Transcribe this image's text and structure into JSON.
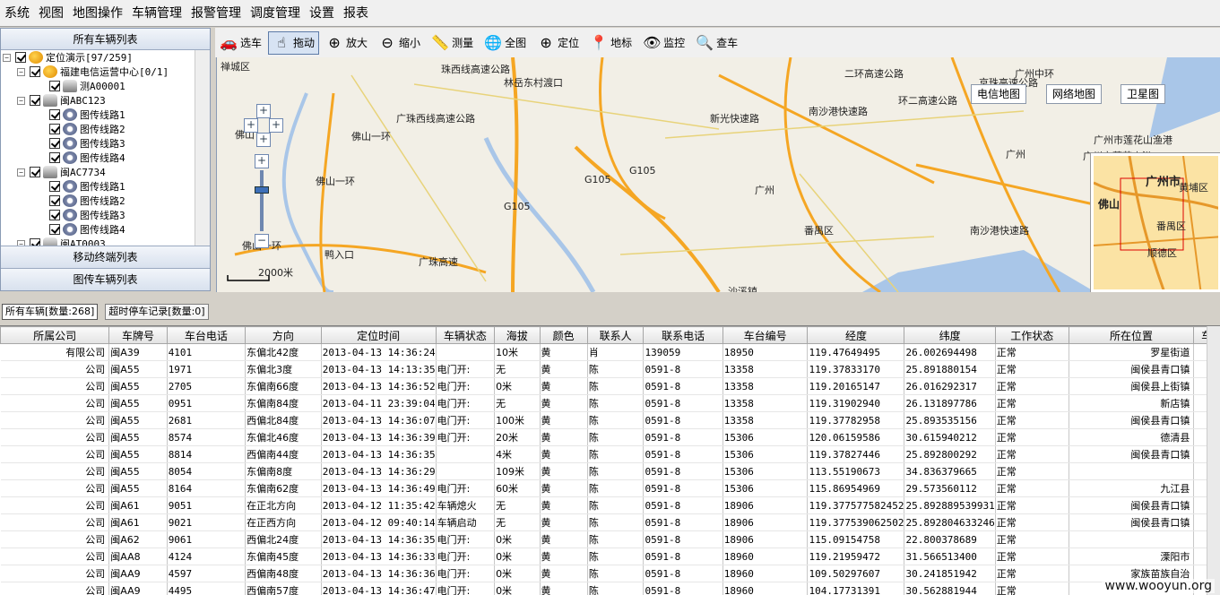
{
  "menu": [
    "系统",
    "视图",
    "地图操作",
    "车辆管理",
    "报警管理",
    "调度管理",
    "设置",
    "报表"
  ],
  "left": {
    "header": "所有车辆列表",
    "tree": [
      {
        "level": 0,
        "exp": "−",
        "icon": "globe-icon",
        "label": "定位演示[97/259]"
      },
      {
        "level": 1,
        "exp": "−",
        "icon": "globe-icon",
        "label": "福建电信运营中心[0/1]"
      },
      {
        "level": 2,
        "exp": "",
        "icon": "car-icon",
        "label": "测A00001"
      },
      {
        "level": 1,
        "exp": "−",
        "icon": "car-icon",
        "label": "闽ABC123"
      },
      {
        "level": 2,
        "exp": "",
        "icon": "camera-icon",
        "label": "图传线路1"
      },
      {
        "level": 2,
        "exp": "",
        "icon": "camera-icon",
        "label": "图传线路2"
      },
      {
        "level": 2,
        "exp": "",
        "icon": "camera-icon",
        "label": "图传线路3"
      },
      {
        "level": 2,
        "exp": "",
        "icon": "camera-icon",
        "label": "图传线路4"
      },
      {
        "level": 1,
        "exp": "−",
        "icon": "car-icon",
        "label": "闽AC7734"
      },
      {
        "level": 2,
        "exp": "",
        "icon": "camera-icon",
        "label": "图传线路1"
      },
      {
        "level": 2,
        "exp": "",
        "icon": "camera-icon",
        "label": "图传线路2"
      },
      {
        "level": 2,
        "exp": "",
        "icon": "camera-icon",
        "label": "图传线路3"
      },
      {
        "level": 2,
        "exp": "",
        "icon": "camera-icon",
        "label": "图传线路4"
      },
      {
        "level": 1,
        "exp": "−",
        "icon": "car-icon",
        "label": "闽AT0003"
      }
    ],
    "acc1": "移动终端列表",
    "acc2": "图传车辆列表"
  },
  "toolbar": [
    {
      "icon": "car-select-icon",
      "glyph": "🚗",
      "label": "选车"
    },
    {
      "icon": "hand-icon",
      "glyph": "☝",
      "label": "拖动",
      "active": true
    },
    {
      "icon": "zoom-in-icon",
      "glyph": "⊕",
      "label": "放大"
    },
    {
      "icon": "zoom-out-icon",
      "glyph": "⊖",
      "label": "缩小"
    },
    {
      "icon": "measure-icon",
      "glyph": "📏",
      "label": "测量"
    },
    {
      "icon": "globe-icon",
      "glyph": "🌐",
      "label": "全图"
    },
    {
      "icon": "crosshair-icon",
      "glyph": "⊕",
      "label": "定位"
    },
    {
      "icon": "pin-icon",
      "glyph": "📍",
      "label": "地标"
    },
    {
      "icon": "eye-icon",
      "glyph": "👁",
      "label": "监控"
    },
    {
      "icon": "search-icon",
      "glyph": "🔍",
      "label": "查车"
    }
  ],
  "map": {
    "btns": [
      "电信地图",
      "网络地图",
      "卫星图"
    ],
    "scale": "2000米",
    "labels": [
      "禅城区",
      "珠西线高速公路",
      "林岳东村渡口",
      "佛山",
      "南沙港快速路",
      "新光快速路",
      "广州市莲花山渔港",
      "广州市莲花山港",
      "番禺区",
      "南沙港快速路",
      "佛山一环",
      "佛山一环",
      "佛山一环",
      "广珠西线高速公路",
      "G105",
      "G105",
      "G105",
      "沙溪镇",
      "鸭入口",
      "广州市",
      "黄埔区",
      "佛山",
      "番禺区",
      "顺德区",
      "广州中环",
      "广州",
      "广州",
      "京珠高速公路",
      "二环高速公路",
      "环二高速公路",
      "广珠高速"
    ],
    "inset_labels": [
      "广州市",
      "黄埔区",
      "佛山",
      "番禺区",
      "顺德区"
    ]
  },
  "tabs": [
    "所有车辆[数量:268]",
    "超时停车记录[数量:0]"
  ],
  "grid": {
    "columns": [
      "所属公司",
      "车牌号",
      "车台电话",
      "方向",
      "定位时间",
      "车辆状态",
      "海拔",
      "颜色",
      "联系人",
      "联系电话",
      "车台编号",
      "经度",
      "纬度",
      "工作状态",
      "所在位置",
      "车"
    ],
    "rows": [
      [
        "有限公司",
        "闽A39",
        "4101",
        "东偏北42度",
        "2013-04-13 14:36:24",
        "",
        "10米",
        "黄",
        "肖",
        "139059",
        "18950",
        "119.47649495",
        "26.002694498",
        "正常",
        "罗星街道"
      ],
      [
        "公司",
        "闽A55",
        "1971",
        "东偏北3度",
        "2013-04-13 14:13:35",
        "电门开:",
        "无",
        "黄",
        "陈",
        "0591-8",
        "13358",
        "119.37833170",
        "25.891880154",
        "正常",
        "闽侯县青口镇"
      ],
      [
        "公司",
        "闽A55",
        "2705",
        "东偏南66度",
        "2013-04-13 14:36:52",
        "电门开:",
        "0米",
        "黄",
        "陈",
        "0591-8",
        "13358",
        "119.20165147",
        "26.016292317",
        "正常",
        "闽侯县上街镇"
      ],
      [
        "公司",
        "闽A55",
        "0951",
        "东偏南84度",
        "2013-04-11 23:39:04",
        "电门开:",
        "无",
        "黄",
        "陈",
        "0591-8",
        "13358",
        "119.31902940",
        "26.131897786",
        "正常",
        "新店镇"
      ],
      [
        "公司",
        "闽A55",
        "2681",
        "西偏北84度",
        "2013-04-13 14:36:07",
        "电门开:",
        "100米",
        "黄",
        "陈",
        "0591-8",
        "13358",
        "119.37782958",
        "25.893535156",
        "正常",
        "闽侯县青口镇"
      ],
      [
        "公司",
        "闽A55",
        "8574",
        "东偏北46度",
        "2013-04-13 14:36:39",
        "电门开:",
        "20米",
        "黄",
        "陈",
        "0591-8",
        "15306",
        "120.06159586",
        "30.615940212",
        "正常",
        "德清县"
      ],
      [
        "公司",
        "闽A55",
        "8814",
        "西偏南44度",
        "2013-04-13 14:36:35",
        "",
        "4米",
        "黄",
        "陈",
        "0591-8",
        "15306",
        "119.37827446",
        "25.892800292",
        "正常",
        "闽侯县青口镇"
      ],
      [
        "公司",
        "闽A55",
        "8054",
        "东偏南8度",
        "2013-04-13 14:36:29",
        "",
        "109米",
        "黄",
        "陈",
        "0591-8",
        "15306",
        "113.55190673",
        "34.836379665",
        "正常",
        ""
      ],
      [
        "公司",
        "闽A55",
        "8164",
        "东偏南62度",
        "2013-04-13 14:36:49",
        "电门开:",
        "60米",
        "黄",
        "陈",
        "0591-8",
        "15306",
        "115.86954969",
        "29.573560112",
        "正常",
        "九江县"
      ],
      [
        "公司",
        "闽A61",
        "9051",
        "在正北方向",
        "2013-04-12 11:35:42",
        "车辆熄火",
        "无",
        "黄",
        "陈",
        "0591-8",
        "18906",
        "119.377577582452",
        "25.892889539931",
        "正常",
        "闽侯县青口镇"
      ],
      [
        "公司",
        "闽A61",
        "9021",
        "在正西方向",
        "2013-04-12 09:40:14",
        "车辆启动",
        "无",
        "黄",
        "陈",
        "0591-8",
        "18906",
        "119.377539062502",
        "25.892804633246",
        "正常",
        "闽侯县青口镇"
      ],
      [
        "公司",
        "闽A62",
        "9061",
        "西偏北24度",
        "2013-04-13 14:36:35",
        "电门开:",
        "0米",
        "黄",
        "陈",
        "0591-8",
        "18906",
        "115.09154758",
        "22.800378689",
        "正常",
        ""
      ],
      [
        "公司",
        "闽AA8",
        "4124",
        "东偏南45度",
        "2013-04-13 14:36:33",
        "电门开:",
        "0米",
        "黄",
        "陈",
        "0591-8",
        "18960",
        "119.21959472",
        "31.566513400",
        "正常",
        "溧阳市"
      ],
      [
        "公司",
        "闽AA9",
        "4597",
        "西偏南48度",
        "2013-04-13 14:36:36",
        "电门开:",
        "0米",
        "黄",
        "陈",
        "0591-8",
        "18960",
        "109.50297607",
        "30.241851942",
        "正常",
        "家族苗族自治"
      ],
      [
        "公司",
        "闽AA9",
        "4495",
        "西偏南57度",
        "2013-04-13 14:36:47",
        "电门开:",
        "0米",
        "黄",
        "陈",
        "0591-8",
        "18960",
        "104.17731391",
        "30.562881944",
        "正常",
        ""
      ]
    ]
  },
  "watermark": "www.wooyun.org"
}
